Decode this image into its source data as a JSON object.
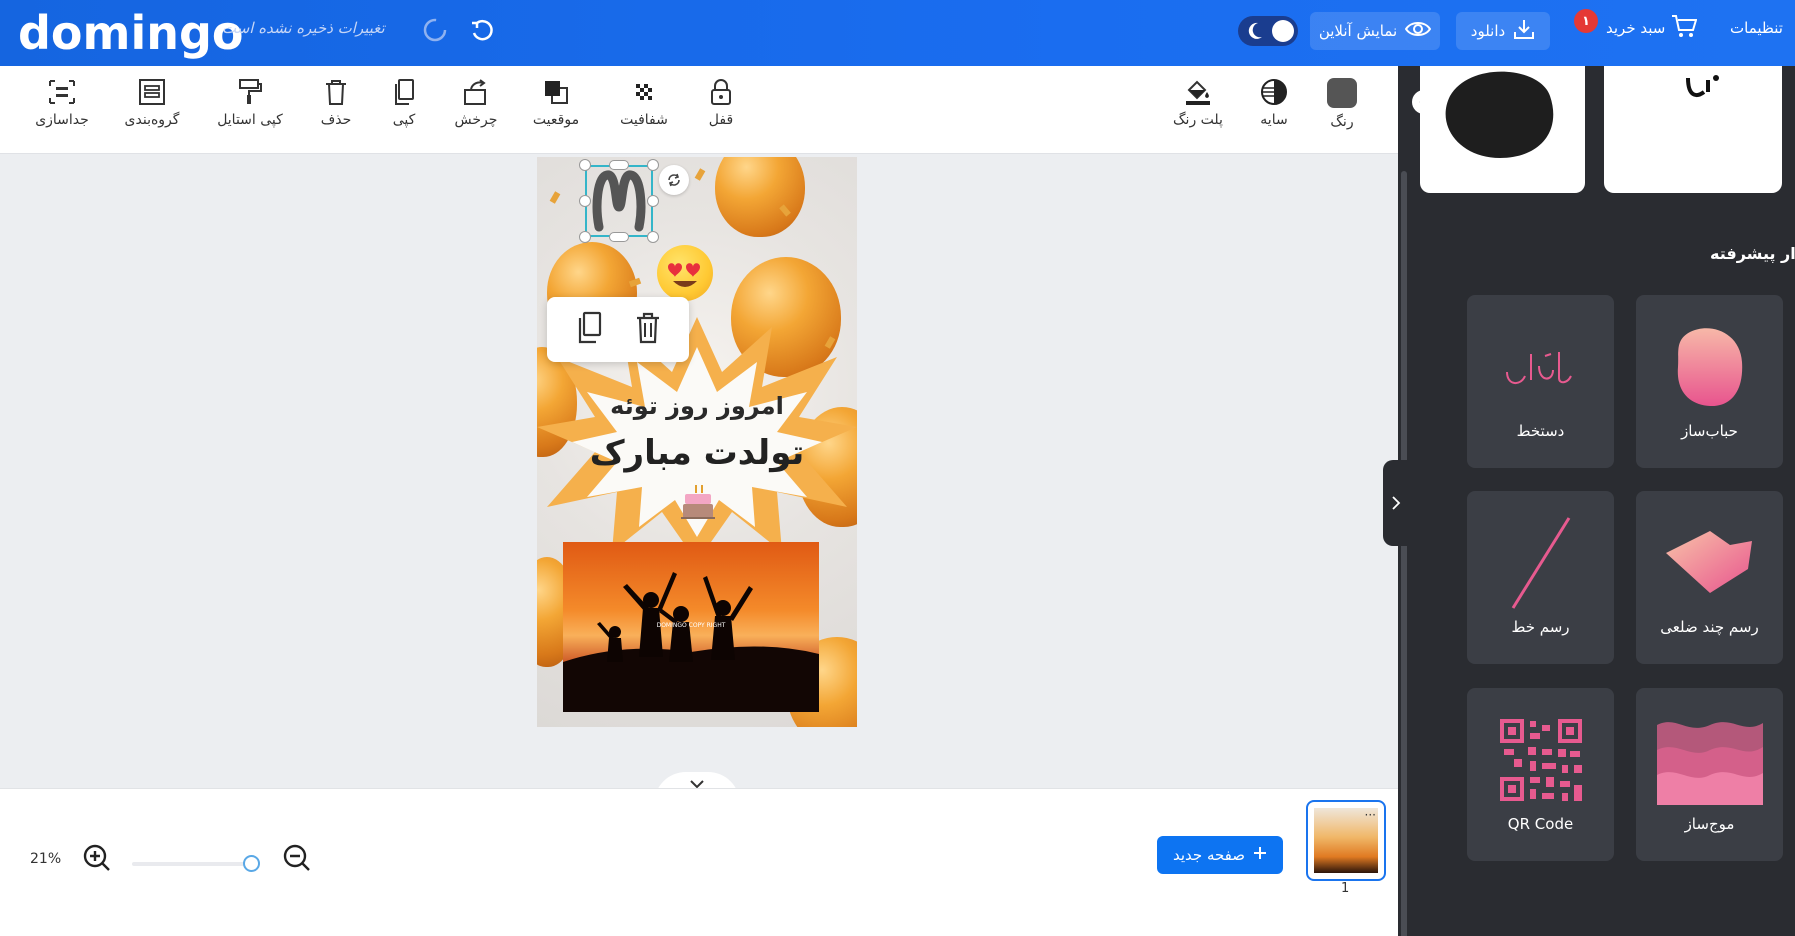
{
  "header": {
    "logo": "domingo",
    "unsaved_status": "تغییرات ذخیره نشده است",
    "online_preview_label": "نمایش آنلاین",
    "download_label": "دانلود",
    "cart_label": "سبد خرید",
    "cart_count": "۱",
    "settings_label": "تنظیمات"
  },
  "toolbar": {
    "left_tools": [
      {
        "label": "جداسازی",
        "icon": "ungroup-icon"
      },
      {
        "label": "گروه‌بندی",
        "icon": "group-icon"
      },
      {
        "label": "کپی استایل",
        "icon": "paint-roller-icon"
      },
      {
        "label": "حذف",
        "icon": "trash-icon"
      },
      {
        "label": "کپی",
        "icon": "copy-icon"
      },
      {
        "label": "چرخش",
        "icon": "rotate-icon"
      },
      {
        "label": "موقعیت",
        "icon": "layers-icon"
      },
      {
        "label": "شفافیت",
        "icon": "transparency-icon"
      },
      {
        "label": "قفل",
        "icon": "lock-icon"
      }
    ],
    "right_tools": [
      {
        "label": "پلت رنگ",
        "icon": "paint-bucket-icon"
      },
      {
        "label": "سایه",
        "icon": "shadow-icon"
      },
      {
        "label": "رنگ",
        "icon": "color-swatch-icon"
      }
    ]
  },
  "canvas": {
    "line1": "امروز روز توئه",
    "line2": "تولدت مبارک",
    "photo_caption": "DOMINGO COPY RIGHT"
  },
  "bottom": {
    "zoom_level": "21%",
    "zoom_fraction": 0.93,
    "new_page_label": "صفحه جدید",
    "page_number": "1"
  },
  "panel": {
    "section_title": "ابزار پیشرفته",
    "cards": [
      {
        "label": "حباب‌ساز",
        "icon": "blob-icon"
      },
      {
        "label": "دستخط",
        "icon": "handwriting-icon",
        "art_text": "ایران"
      },
      {
        "label": "رسم چند ضلعی",
        "icon": "polygon-icon"
      },
      {
        "label": "رسم خط",
        "icon": "line-icon"
      },
      {
        "label": "موج‌ساز",
        "icon": "wave-icon"
      },
      {
        "label": "QR Code",
        "icon": "qr-code-icon"
      }
    ]
  },
  "colors": {
    "header": "#1a6df0",
    "accent": "#0d74f2",
    "panel_bg": "#2a2c31",
    "card_bg": "#3b3e45",
    "pink": "#e75a8f"
  }
}
